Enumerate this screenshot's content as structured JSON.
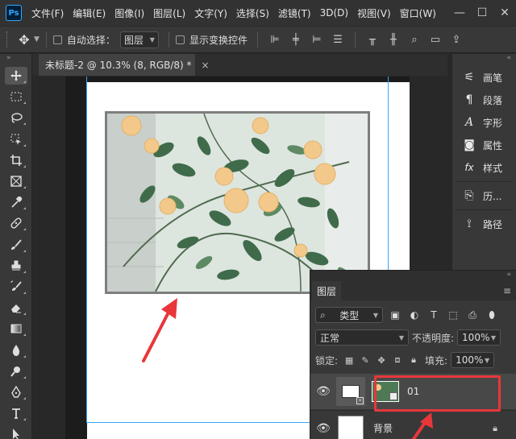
{
  "app": {
    "logo": "Ps",
    "menu": [
      "文件(F)",
      "编辑(E)",
      "图像(I)",
      "图层(L)",
      "文字(Y)",
      "选择(S)",
      "滤镜(T)",
      "3D(D)",
      "视图(V)",
      "窗口(W)"
    ]
  },
  "window_controls": {
    "minimize": "—",
    "maximize": "☐",
    "close": "✕"
  },
  "options": {
    "auto_select_label": "自动选择：",
    "auto_select_value": "图层",
    "show_transform_label": "显示变换控件"
  },
  "document_tab": {
    "title": "未标题-2 @ 10.3% (8, RGB/8) *",
    "close": "×"
  },
  "dock_panels": [
    "画笔",
    "段落",
    "字形",
    "属性",
    "样式",
    "历...",
    "路径"
  ],
  "layers_panel": {
    "title": "图层",
    "filter_label": "类型",
    "blend_mode": "正常",
    "opacity_label": "不透明度:",
    "opacity_value": "100%",
    "lock_label": "锁定:",
    "fill_label": "填充:",
    "fill_value": "100%",
    "layers": [
      {
        "name": "01",
        "visible": true,
        "selected": true
      },
      {
        "name": "背景",
        "visible": true,
        "locked": true
      }
    ]
  },
  "colors": {
    "accent_red": "#e8373b",
    "guide_blue": "#39a5ff"
  }
}
